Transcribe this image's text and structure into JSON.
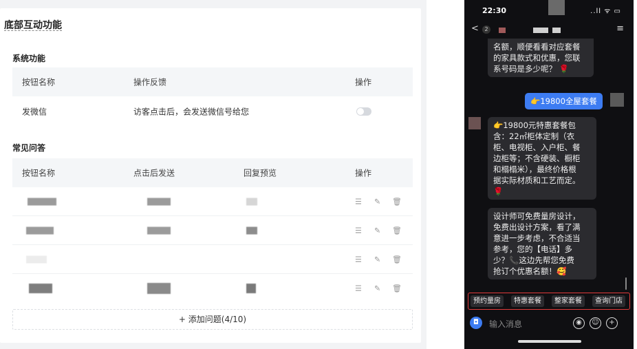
{
  "admin": {
    "page_title": "底部互动功能",
    "system_section": {
      "title": "系统功能",
      "headers": [
        "按钮名称",
        "操作反馈",
        "操作"
      ],
      "rows": [
        {
          "name": "发微信",
          "feedback": "访客点击后，会发送微信号给您",
          "enabled": false
        }
      ]
    },
    "faq_section": {
      "title": "常见问答",
      "headers": [
        "按钮名称",
        "点击后发送",
        "回复预览",
        "操作"
      ],
      "row_count": 4,
      "add_button": "+ 添加问题(4/10)"
    },
    "row_actions": {
      "drag_icon": "☰",
      "edit_icon": "✎",
      "delete_icon": "🗑"
    }
  },
  "phone": {
    "status": {
      "time": "22:30",
      "signal": "..ll ᯤ ▭"
    },
    "nav": {
      "back": "<",
      "badge": "2",
      "menu": "≡"
    },
    "messages": {
      "bot1": [
        "名额，顺便看看对应套餐",
        "的家具款式和优惠，您联",
        "系号码是多少呢？ 🌹"
      ],
      "user1": "👉19800全屋套餐",
      "bot2": [
        "👉19800元特惠套餐包",
        "含：22㎡柜体定制（衣",
        "柜、电视柜、入户柜、餐",
        "边柜等；不含硬装、橱柜",
        "和榻榻米），最终价格根",
        "据实际材质和工艺而定。",
        "🌹"
      ],
      "bot3": [
        "设计师可免费量房设计，",
        "免费出设计方案，看了满",
        "意进一步考虑，不合适当",
        "参考，您的【电话】多",
        "少？📞这边先帮您免费",
        "抢订个优惠名额！🥰"
      ]
    },
    "quick_replies": [
      "预约量房",
      "特惠套餐",
      "整家套餐",
      "查询门店"
    ],
    "input": {
      "placeholder": "输入消息",
      "voice_icon": "◉",
      "emoji_icon": "☺",
      "plus_icon": "+",
      "camera_icon": "◘"
    }
  },
  "colors": {
    "accent": "#3d7cf2",
    "highlight_border": "#e23b3b"
  }
}
